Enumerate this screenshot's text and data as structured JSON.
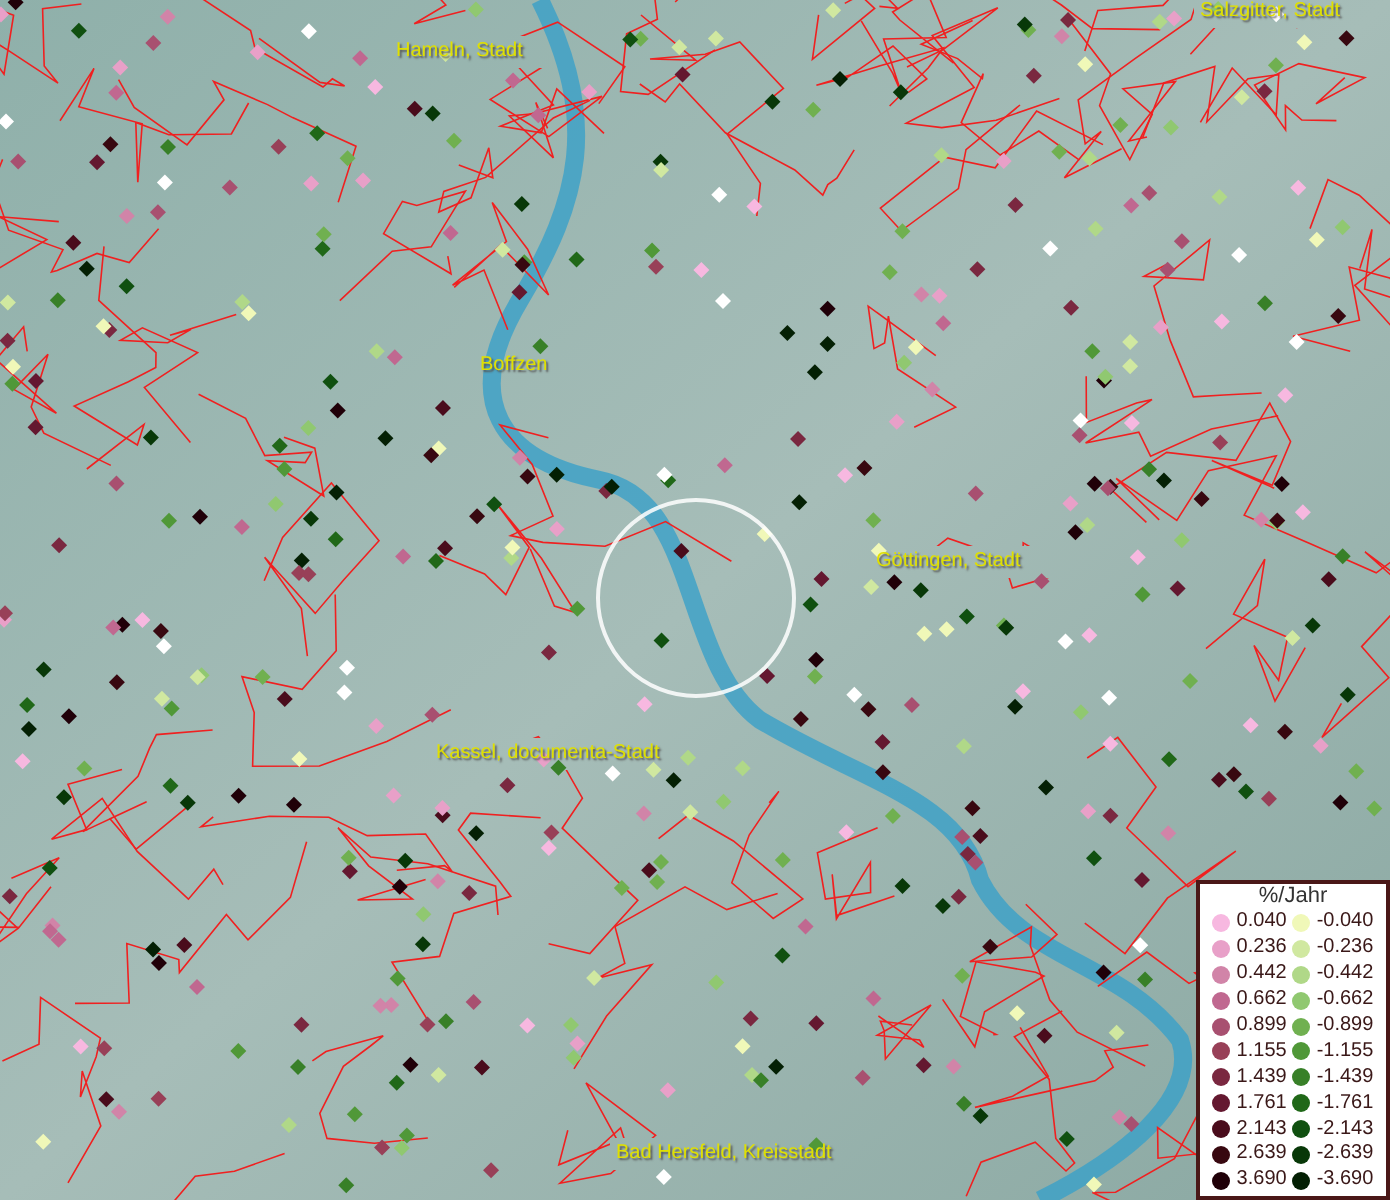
{
  "map": {
    "places": [
      {
        "name": "Hameln, Stadt"
      },
      {
        "name": "Salzgitter, Stadt"
      },
      {
        "name": "Boffzen"
      },
      {
        "name": "Göttingen, Stadt"
      },
      {
        "name": "Kassel, documenta-Stadt"
      },
      {
        "name": "Bad Hersfeld, Kreisstadt"
      }
    ]
  },
  "legend": {
    "title": "%/Jahr",
    "columns": [
      [
        {
          "value": "0.040",
          "color": "#f7b8e0"
        },
        {
          "value": "0.236",
          "color": "#e8a0c8"
        },
        {
          "value": "0.442",
          "color": "#d184a8"
        },
        {
          "value": "0.662",
          "color": "#c06890"
        },
        {
          "value": "0.899",
          "color": "#a85070"
        },
        {
          "value": "1.155",
          "color": "#984058"
        },
        {
          "value": "1.439",
          "color": "#7a2840"
        },
        {
          "value": "1.761",
          "color": "#641830"
        },
        {
          "value": "2.143",
          "color": "#4a0c1c"
        },
        {
          "value": "2.639",
          "color": "#380810"
        },
        {
          "value": "3.690",
          "color": "#200008"
        }
      ],
      [
        {
          "value": "-0.040",
          "color": "#f0f8b8"
        },
        {
          "value": "-0.236",
          "color": "#d0e8a0"
        },
        {
          "value": "-0.442",
          "color": "#b0d888"
        },
        {
          "value": "-0.662",
          "color": "#90c870"
        },
        {
          "value": "-0.899",
          "color": "#70b050"
        },
        {
          "value": "-1.155",
          "color": "#509838"
        },
        {
          "value": "-1.439",
          "color": "#388028"
        },
        {
          "value": "-1.761",
          "color": "#206818"
        },
        {
          "value": "-2.143",
          "color": "#105010"
        },
        {
          "value": "-2.639",
          "color": "#083808"
        },
        {
          "value": "-3.690",
          "color": "#042004"
        }
      ]
    ]
  }
}
